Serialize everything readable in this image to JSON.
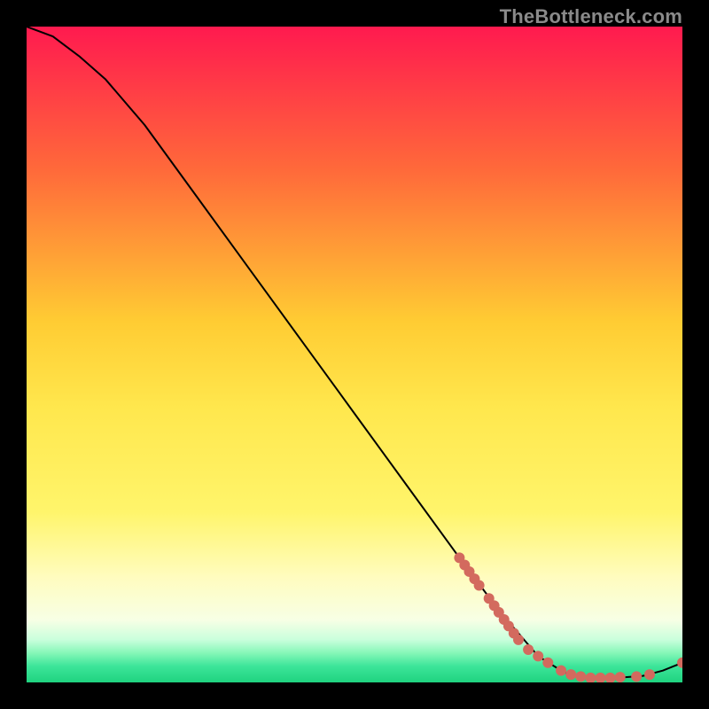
{
  "watermark": "TheBottleneck.com",
  "chart_data": {
    "type": "line",
    "title": "",
    "xlabel": "",
    "ylabel": "",
    "xlim": [
      0,
      100
    ],
    "ylim": [
      0,
      100
    ],
    "gradient_stops": [
      {
        "offset": 0,
        "color": "#ff1a4f"
      },
      {
        "offset": 0.22,
        "color": "#ff6a3a"
      },
      {
        "offset": 0.45,
        "color": "#ffcc33"
      },
      {
        "offset": 0.58,
        "color": "#ffe74d"
      },
      {
        "offset": 0.74,
        "color": "#fff56b"
      },
      {
        "offset": 0.84,
        "color": "#fffcbf"
      },
      {
        "offset": 0.905,
        "color": "#f7ffe5"
      },
      {
        "offset": 0.935,
        "color": "#c9ffdc"
      },
      {
        "offset": 0.955,
        "color": "#86f7b8"
      },
      {
        "offset": 0.975,
        "color": "#3de59a"
      },
      {
        "offset": 1.0,
        "color": "#1fd37f"
      }
    ],
    "curve": [
      {
        "x": 0,
        "y": 100
      },
      {
        "x": 4,
        "y": 98.5
      },
      {
        "x": 8,
        "y": 95.5
      },
      {
        "x": 12,
        "y": 92.0
      },
      {
        "x": 18,
        "y": 85.0
      },
      {
        "x": 26,
        "y": 74.0
      },
      {
        "x": 34,
        "y": 63.0
      },
      {
        "x": 42,
        "y": 52.0
      },
      {
        "x": 50,
        "y": 41.0
      },
      {
        "x": 58,
        "y": 30.0
      },
      {
        "x": 66,
        "y": 19.0
      },
      {
        "x": 72,
        "y": 11.0
      },
      {
        "x": 78,
        "y": 4.0
      },
      {
        "x": 82,
        "y": 1.5
      },
      {
        "x": 86,
        "y": 0.7
      },
      {
        "x": 90,
        "y": 0.7
      },
      {
        "x": 94,
        "y": 1.0
      },
      {
        "x": 97,
        "y": 1.8
      },
      {
        "x": 100,
        "y": 3.0
      }
    ],
    "markers": [
      {
        "x": 66.0,
        "y": 19.0
      },
      {
        "x": 66.8,
        "y": 17.9
      },
      {
        "x": 67.5,
        "y": 16.9
      },
      {
        "x": 68.3,
        "y": 15.8
      },
      {
        "x": 69.0,
        "y": 14.8
      },
      {
        "x": 70.5,
        "y": 12.8
      },
      {
        "x": 71.3,
        "y": 11.7
      },
      {
        "x": 72.0,
        "y": 10.7
      },
      {
        "x": 72.8,
        "y": 9.6
      },
      {
        "x": 73.5,
        "y": 8.6
      },
      {
        "x": 74.3,
        "y": 7.5
      },
      {
        "x": 75.0,
        "y": 6.5
      },
      {
        "x": 76.5,
        "y": 5.0
      },
      {
        "x": 78.0,
        "y": 4.0
      },
      {
        "x": 79.5,
        "y": 3.0
      },
      {
        "x": 81.5,
        "y": 1.8
      },
      {
        "x": 83.0,
        "y": 1.2
      },
      {
        "x": 84.5,
        "y": 0.9
      },
      {
        "x": 86.0,
        "y": 0.7
      },
      {
        "x": 87.5,
        "y": 0.7
      },
      {
        "x": 89.0,
        "y": 0.7
      },
      {
        "x": 90.5,
        "y": 0.8
      },
      {
        "x": 93.0,
        "y": 0.9
      },
      {
        "x": 95.0,
        "y": 1.2
      },
      {
        "x": 100.0,
        "y": 3.0
      }
    ],
    "marker_color": "#d36a5e",
    "line_color": "#000000"
  }
}
